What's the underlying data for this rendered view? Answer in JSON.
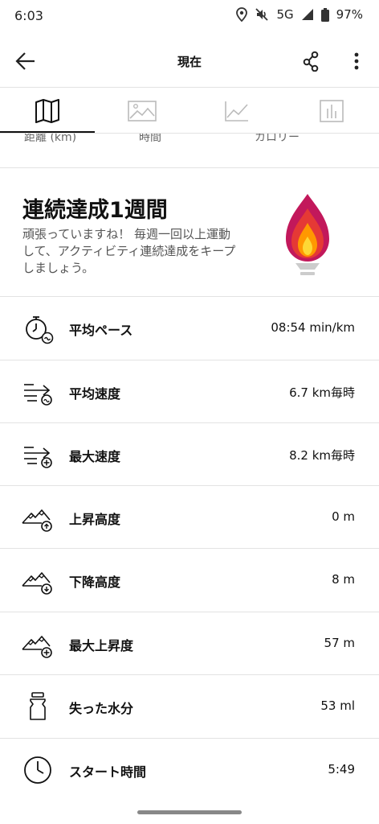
{
  "status_bar": {
    "time": "6:03",
    "network": "5G",
    "battery": "97%",
    "icons": [
      "location-icon",
      "mute-icon",
      "signal-icon",
      "battery-icon"
    ]
  },
  "app_bar": {
    "title": "現在",
    "icons": [
      "back-arrow-icon",
      "share-icon",
      "more-vert-icon"
    ]
  },
  "tabs": [
    {
      "name": "map",
      "icon": "map-icon",
      "selected": true
    },
    {
      "name": "photos",
      "icon": "image-icon",
      "selected": false
    },
    {
      "name": "graph",
      "icon": "line-chart-icon",
      "selected": false
    },
    {
      "name": "stats",
      "icon": "bar-chart-icon",
      "selected": false
    }
  ],
  "peek": {
    "distance_label": "距離 (km)",
    "time_label": "時間",
    "calories_label": "カロリー"
  },
  "streak": {
    "title": "連続達成1週間",
    "message": "頑張っていますね！ 毎週一回以上運動して、アクティビティ連続達成をキープしましょう。",
    "icon": "flame-torch-icon",
    "colors": {
      "outer": "#c2185b",
      "mid": "#e53935",
      "inner": "#ff9800",
      "core": "#fdd835",
      "base": "#cccccc"
    }
  },
  "stats": [
    {
      "name": "avg-pace",
      "icon": "stopwatch-icon",
      "label": "平均ペース",
      "value": "08:54 min/km"
    },
    {
      "name": "avg-speed",
      "icon": "speed-avg-icon",
      "label": "平均速度",
      "value": "6.7 km毎時"
    },
    {
      "name": "max-speed",
      "icon": "speed-max-icon",
      "label": "最大速度",
      "value": "8.2 km毎時"
    },
    {
      "name": "elevation-gain",
      "icon": "mountain-up-icon",
      "label": "上昇高度",
      "value": "0 m"
    },
    {
      "name": "elevation-loss",
      "icon": "mountain-down-icon",
      "label": "下降高度",
      "value": "8 m"
    },
    {
      "name": "max-elevation",
      "icon": "mountain-max-icon",
      "label": "最大上昇度",
      "value": "57 m"
    },
    {
      "name": "water-loss",
      "icon": "bottle-icon",
      "label": "失った水分",
      "value": "53 ml"
    },
    {
      "name": "start-time",
      "icon": "clock-icon",
      "label": "スタート時間",
      "value": "5:49"
    }
  ]
}
